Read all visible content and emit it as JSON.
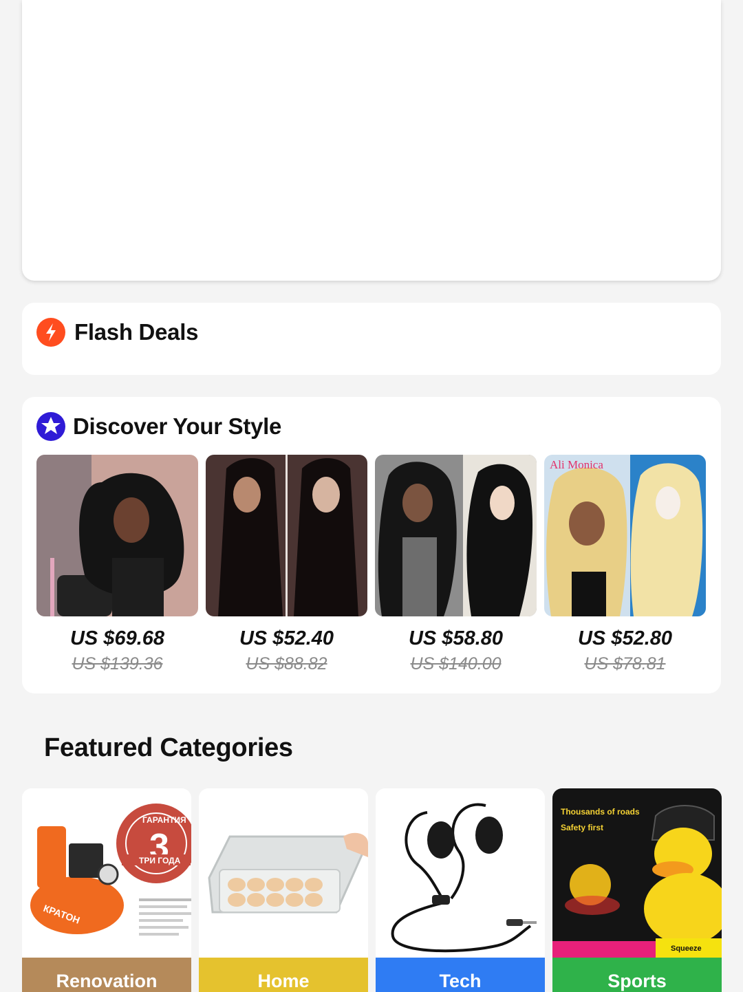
{
  "flash_deals": {
    "title": "Flash Deals"
  },
  "discover": {
    "title": "Discover Your Style",
    "products": [
      {
        "price": "US $69.68",
        "old_price": "US $139.36"
      },
      {
        "price": "US $52.40",
        "old_price": "US $88.82"
      },
      {
        "price": "US $58.80",
        "old_price": "US $140.00"
      },
      {
        "price": "US $52.80",
        "old_price": "US $78.81",
        "image_text": "Ali Monica"
      }
    ]
  },
  "featured": {
    "title": "Featured Categories",
    "categories": [
      {
        "label": "Renovation",
        "color": "#b58a5a",
        "image_text": [
          "ГАРАНТИЯ",
          "3",
          "ТРИ ГОДА",
          "КРАТОН"
        ]
      },
      {
        "label": "Home",
        "color": "#e5c22e"
      },
      {
        "label": "Tech",
        "color": "#2f7cf3"
      },
      {
        "label": "Sports",
        "color": "#2fb24a",
        "image_text": [
          "Thousands of roads",
          "Safety first",
          "Squeeze"
        ]
      }
    ]
  },
  "colors": {
    "flash_icon": "#ff4d1f",
    "discover_icon": "#2f1bd6"
  }
}
